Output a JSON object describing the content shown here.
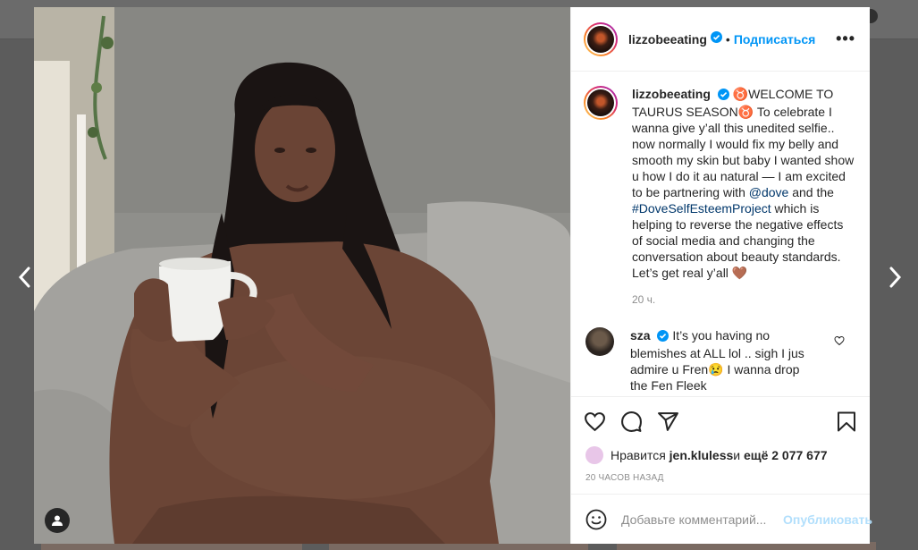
{
  "post": {
    "author": "lizzobeeating",
    "follow_label": "Подписаться",
    "dot": "•",
    "more_label": "•••"
  },
  "caption": {
    "username": "lizzobeeating",
    "text_before_mention": " ♉️WELCOME TO TAURUS SEASON♉️ To celebrate I wanna give y’all this unedited selfie.. now normally I would fix my belly and smooth my skin but baby I wanted show u how I do it au natural — I am excited to be partnering with ",
    "mention": "@dove",
    "text_between": " and the ",
    "hashtag": "#DoveSelfEsteemProject",
    "text_after": " which is helping to reverse the negative effects of social media and changing the conversation about beauty standards. Let’s get real y’all ",
    "emoji": "🤎",
    "time": "20 ч."
  },
  "comment": {
    "username": "sza",
    "text": " It’s you having no blemishes at ALL lol .. sigh I jus admire u Fren😢 I wanna drop the Fen Fleek"
  },
  "likes": {
    "prefix": "Нравится ",
    "user": "jen.kluless",
    "middle": " и ",
    "count": "ещё 2 077 677"
  },
  "time_ago": "20 ЧАСОВ НАЗАД",
  "add_comment": {
    "placeholder": "Добавьте комментарий...",
    "publish_label": "Опубликовать"
  },
  "colors": {
    "accent": "#0095f6",
    "link": "#00376b",
    "publish_disabled": "#b2dffc"
  }
}
